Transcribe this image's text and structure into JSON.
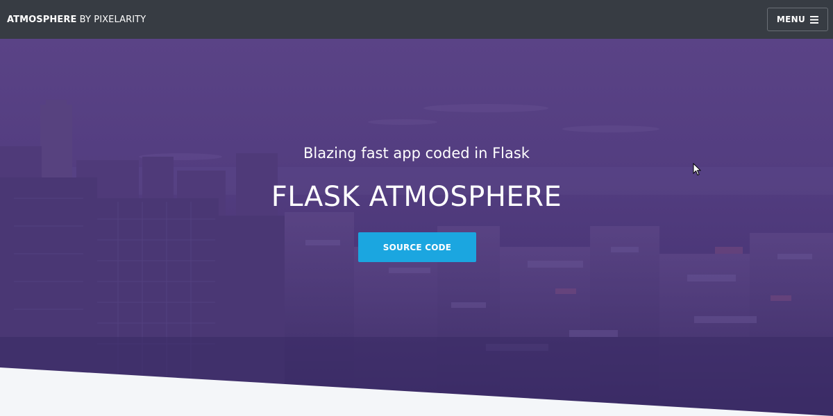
{
  "navbar": {
    "brand_strong": "ATMOSPHERE",
    "brand_light": " BY PIXELARITY",
    "menu_label": "MENU",
    "menu_icon": "hamburger-icon"
  },
  "hero": {
    "subtitle": "Blazing fast app coded in Flask",
    "title": "FLASK ATMOSPHERE",
    "button_label": "SOURCE CODE",
    "overlay_color": "#4f3a7e",
    "button_color": "#1ba6e0"
  },
  "colors": {
    "navbar_bg": "#373c43",
    "page_bg": "#f4f6f9"
  }
}
